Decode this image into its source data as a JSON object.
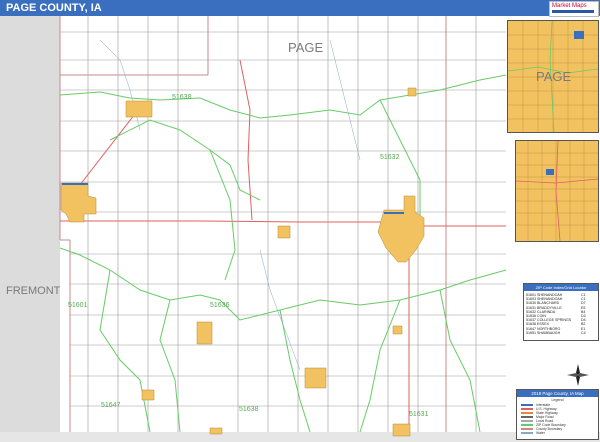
{
  "title": "PAGE COUNTY, IA",
  "logo_text": "Market Maps",
  "labels": {
    "county_name": "PAGE",
    "neighbor_county": "FREMONT",
    "inset_county": "PAGE"
  },
  "zip_labels": [
    "51638",
    "51632",
    "51601",
    "51636",
    "51647",
    "51638",
    "51631"
  ],
  "zip_table": {
    "header": "ZIP Code Index/Grid Locator",
    "rows": [
      {
        "zip": "51601",
        "name": "SHENANDOAH",
        "grid": "C1"
      },
      {
        "zip": "51603",
        "name": "SHENANDOAH",
        "grid": "C1"
      },
      {
        "zip": "51630",
        "name": "BLANCHARD",
        "grid": "D7"
      },
      {
        "zip": "51631",
        "name": "BRADDYVILLE",
        "grid": "E5"
      },
      {
        "zip": "51632",
        "name": "CLARINDA",
        "grid": "B4"
      },
      {
        "zip": "51636",
        "name": "COIN",
        "grid": "D3"
      },
      {
        "zip": "51637",
        "name": "COLLEGE SPRINGS",
        "grid": "D4"
      },
      {
        "zip": "51638",
        "name": "ESSEX",
        "grid": "B2"
      },
      {
        "zip": "51647",
        "name": "NORTHBORO",
        "grid": "E1"
      },
      {
        "zip": "51651",
        "name": "SHAMBAUGH",
        "grid": "C4"
      }
    ]
  },
  "legend": {
    "header": "2018 Page County, IA Map",
    "subheader": "Legend",
    "items": [
      "Interstate",
      "U.S. Highway",
      "State Highway",
      "Major Road",
      "Local Road",
      "ZIP Code Boundary",
      "County Boundary",
      "Water"
    ]
  },
  "colors": {
    "title_bar": "#3a6fbf",
    "town": "#f3c260",
    "zip_boundary": "#66cc66",
    "highway": "#e06060",
    "county_boundary": "#c98a8a",
    "outside": "#dcdcdc"
  }
}
